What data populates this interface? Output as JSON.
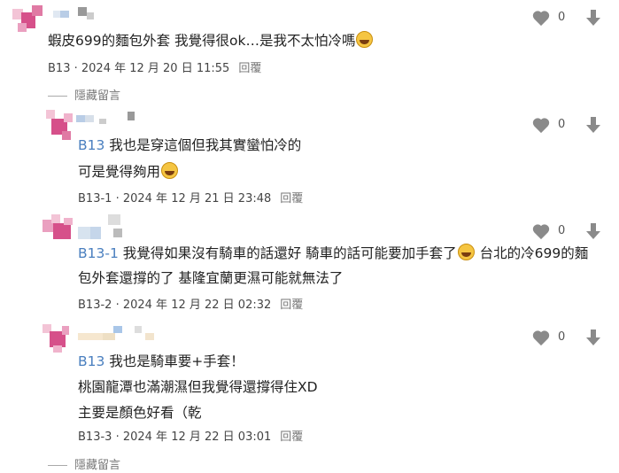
{
  "comments": [
    {
      "tag": "",
      "lines": [
        "蝦皮699的麵包外套 我覺得很ok…是我不太怕冷嗎"
      ],
      "emoji_after_line": [
        0
      ],
      "id": "B13",
      "date": "2024 年 12 月 20 日 11:55",
      "reply_label": "回覆",
      "likes": "0"
    },
    {
      "tag": "B13",
      "lines": [
        "我也是穿這個但我其實蠻怕冷的",
        "可是覺得夠用"
      ],
      "emoji_after_line": [
        1
      ],
      "id": "B13-1",
      "date": "2024 年 12 月 21 日 23:48",
      "reply_label": "回覆",
      "likes": "0"
    },
    {
      "tag": "B13-1",
      "lines": [
        "我覺得如果沒有騎車的話還好 騎車的話可能要加手套了",
        "台北的冷699的麵",
        "包外套還撐的了 基隆宜蘭更濕可能就無法了"
      ],
      "emoji_after_line": [
        0
      ],
      "id": "B13-2",
      "date": "2024 年 12 月 22 日 02:32",
      "reply_label": "回覆",
      "likes": "0"
    },
    {
      "tag": "B13",
      "lines": [
        "我也是騎車要+手套！",
        "桃園龍潭也滿潮濕但我覺得還撐得住XD",
        "主要是顏色好看（乾"
      ],
      "emoji_after_line": [],
      "id": "B13-3",
      "date": "2024 年 12 月 22 日 03:01",
      "reply_label": "回覆",
      "likes": "0"
    }
  ],
  "hidden_label": "隱藏留言",
  "icons": {
    "like": "heart-icon",
    "dislike": "thumb-down-icon",
    "reply_emoji": "grinning-emoji-icon"
  },
  "colors": {
    "tag": "#4a7fbf",
    "icon": "#8a8a8a",
    "avatar_pink": "#d6508a"
  }
}
